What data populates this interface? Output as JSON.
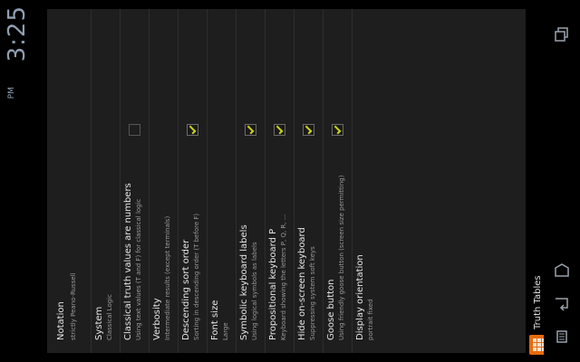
{
  "status_bar": {
    "time": "3:25",
    "ampm": "PM"
  },
  "app": {
    "title": "Truth Tables",
    "icon": "app-grid-icon"
  },
  "settings": [
    {
      "title": "Notation",
      "subtitle": "strictly Peano-Russell",
      "checkbox": null
    },
    {
      "title": "System",
      "subtitle": "Classical Logic",
      "checkbox": null
    },
    {
      "title": "Classical truth values are numbers",
      "subtitle": "Using text values (T and F) for classical logic",
      "checkbox": false
    },
    {
      "title": "Verbosity",
      "subtitle": "Intermediate results (except terminals)",
      "checkbox": null
    },
    {
      "title": "Descending sort order",
      "subtitle": "Sorting in descending order (T before F)",
      "checkbox": true
    },
    {
      "title": "Font size",
      "subtitle": "Large",
      "checkbox": null
    },
    {
      "title": "Symbolic keyboard labels",
      "subtitle": "Using logical symbols as labels",
      "checkbox": true
    },
    {
      "title": "Propositional keyboard P",
      "subtitle": "Keyboard showing the letters P, Q, R, ...",
      "checkbox": true
    },
    {
      "title": "Hide on-screen keyboard",
      "subtitle": "Suppressing system soft keys",
      "checkbox": true
    },
    {
      "title": "Goose button",
      "subtitle": "Using friendly goose button (screen size permitting)",
      "checkbox": true
    },
    {
      "title": "Display orientation",
      "subtitle": "portrait fixed",
      "checkbox": null
    }
  ],
  "navbar": {
    "back": "back-icon",
    "home": "home-icon",
    "recent": "recent-apps-icon",
    "menu": "menu-icon"
  },
  "colors": {
    "check_accent": "#c9d21a",
    "app_icon": "#e86a0c",
    "clock": "#8fa0b2"
  }
}
